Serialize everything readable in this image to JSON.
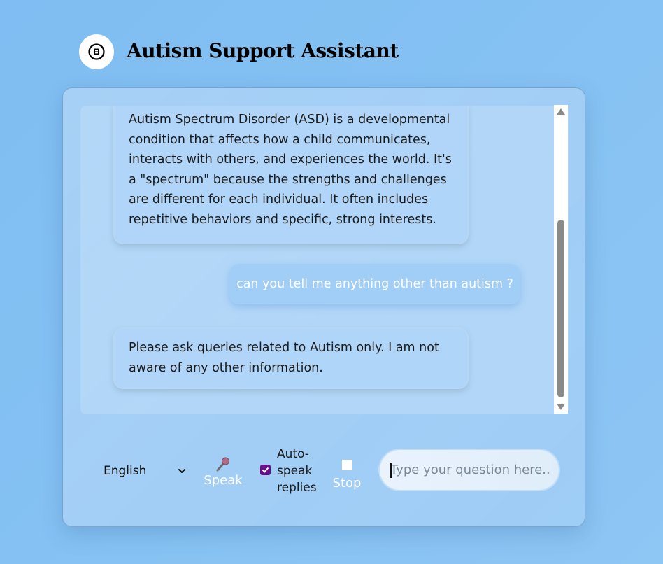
{
  "header": {
    "logo_icon": "robot-face-icon",
    "title": "Autism Support Assistant"
  },
  "chat": {
    "messages": [
      {
        "role": "assistant",
        "text": "Autism Spectrum Disorder (ASD) is a developmental condition that affects how a child communicates, interacts with others, and experiences the world. It's a \"spectrum\" because the strengths and challenges are different for each individual. It often includes repetitive behaviors and specific, strong interests."
      },
      {
        "role": "user",
        "text": "can you tell me anything other than autism ?"
      },
      {
        "role": "assistant",
        "text": "Please ask queries related to Autism only. I am not aware of any other information."
      }
    ]
  },
  "controls": {
    "language": {
      "selected": "English"
    },
    "speak": {
      "icon": "microphone-icon",
      "label": "Speak"
    },
    "auto_speak": {
      "checked": true,
      "label": "Auto-speak replies"
    },
    "stop": {
      "icon": "stop-square-icon",
      "label": "Stop"
    },
    "input": {
      "value": "",
      "placeholder": "Type your question here..."
    }
  },
  "colors": {
    "user_text": "#ffffff",
    "checkbox_accent": "#6a0f8a"
  }
}
